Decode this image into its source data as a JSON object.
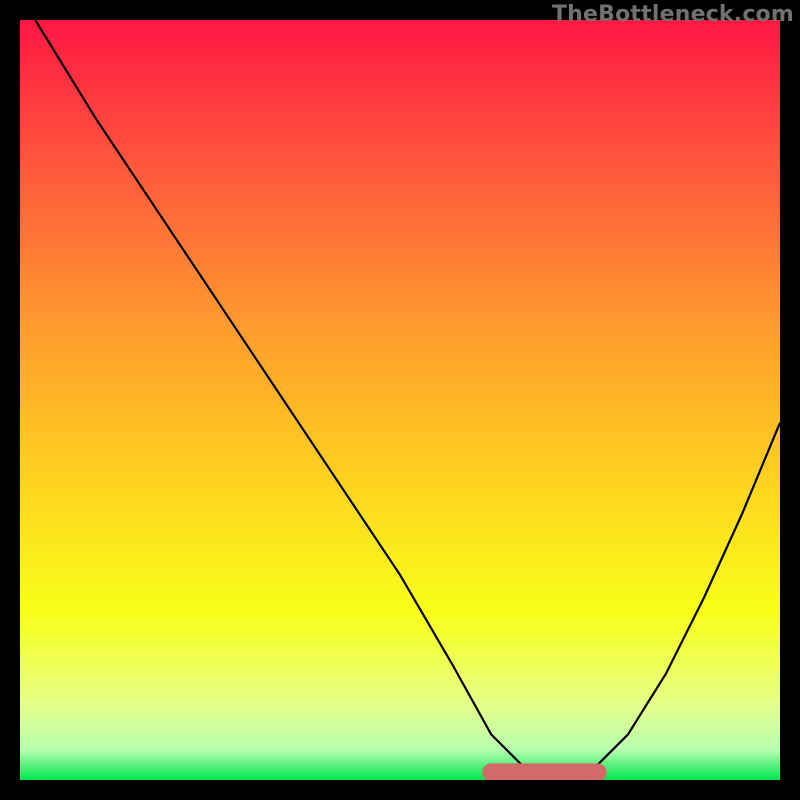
{
  "attribution": "TheBottleneck.com",
  "chart_data": {
    "type": "line",
    "title": "",
    "xlabel": "",
    "ylabel": "",
    "xlim": [
      0,
      100
    ],
    "ylim": [
      0,
      100
    ],
    "series": [
      {
        "name": "bottleneck-curve",
        "x": [
          2,
          10,
          20,
          30,
          40,
          50,
          57,
          62,
          66,
          70,
          73,
          76,
          80,
          85,
          90,
          95,
          100
        ],
        "y": [
          100,
          87,
          72,
          57,
          42,
          27,
          15,
          6,
          2,
          1,
          1,
          2,
          6,
          14,
          24,
          35,
          47
        ]
      },
      {
        "name": "optimal-flat-zone",
        "x": [
          62,
          76
        ],
        "y": [
          1,
          1
        ]
      }
    ],
    "gradient_stops": [
      {
        "offset": 0.0,
        "color": "#ff1744"
      },
      {
        "offset": 0.2,
        "color": "#ff5a3c"
      },
      {
        "offset": 0.4,
        "color": "#ff9a2e"
      },
      {
        "offset": 0.6,
        "color": "#ffd11f"
      },
      {
        "offset": 0.78,
        "color": "#f8ff19"
      },
      {
        "offset": 0.9,
        "color": "#e6ff8a"
      },
      {
        "offset": 0.96,
        "color": "#b7ffb0"
      },
      {
        "offset": 1.0,
        "color": "#00e64d"
      }
    ],
    "optimal_marker_color": "#d26a6a"
  }
}
